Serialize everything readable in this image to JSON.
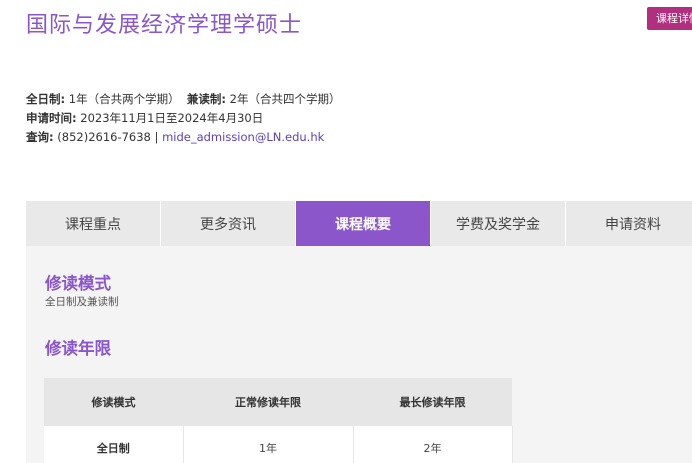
{
  "header": {
    "title": "国际与发展经济学理学硕士",
    "detail_button": "课程详情"
  },
  "info": {
    "fulltime_label": "全日制:",
    "fulltime_value": " 1年（合共两个学期）",
    "parttime_label": "兼读制:",
    "parttime_value": " 2年（合共四个学期）",
    "apply_label": "申请时间:",
    "apply_value": " 2023年11月1日至2024年4月30日",
    "enquiry_label": "查询:",
    "enquiry_phone": " (852)2616-7638 | ",
    "enquiry_email": "mide_admission@LN.edu.hk"
  },
  "tabs": [
    {
      "label": "课程重点",
      "active": false
    },
    {
      "label": "更多资讯",
      "active": false
    },
    {
      "label": "课程概要",
      "active": true
    },
    {
      "label": "学费及奖学金",
      "active": false
    },
    {
      "label": "申请资料",
      "active": false
    }
  ],
  "content": {
    "mode_title": "修读模式",
    "mode_text": "全日制及兼读制",
    "duration_title": "修读年限",
    "table": {
      "headers": [
        "修读模式",
        "正常修读年限",
        "最长修读年限"
      ],
      "rows": [
        [
          "全日制",
          "1年",
          "2年"
        ]
      ]
    }
  }
}
